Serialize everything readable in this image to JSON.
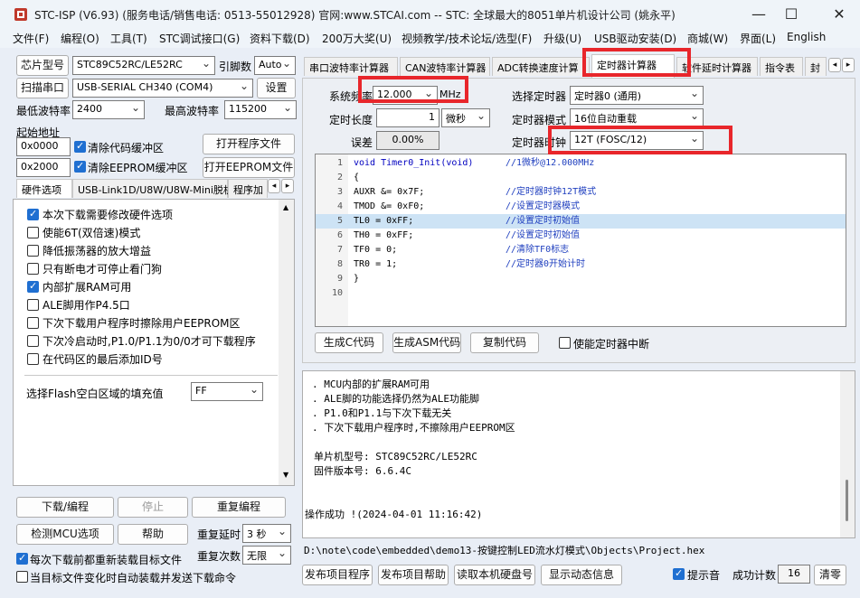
{
  "titlebar": {
    "title": "STC-ISP (V6.93) (服务电话/销售电话: 0513-55012928) 官网:www.STCAI.com  -- STC: 全球最大的8051单片机设计公司 (姚永平)",
    "minimize": "—",
    "maximize": "☐",
    "close": "✕"
  },
  "menu": [
    "文件(F)",
    "编程(O)",
    "工具(T)",
    "STC调试接口(G)",
    "资料下载(D)",
    "200万大奖(U)",
    "视频教学/技术论坛/选型(F)",
    "升级(U)",
    "USB驱动安装(D)",
    "商城(W)",
    "界面(L)",
    "English"
  ],
  "left": {
    "chip_model_btn": "芯片型号",
    "chip_model": "STC89C52RC/LE52RC",
    "pin_label": "引脚数",
    "pin_value": "Auto",
    "scan_port_btn": "扫描串口",
    "port_value": "USB-SERIAL CH340 (COM4)",
    "settings_btn": "设置",
    "min_baud_label": "最低波特率",
    "min_baud": "2400",
    "max_baud_label": "最高波特率",
    "max_baud": "115200",
    "start_addr_label": "起始地址",
    "addr1": "0x0000",
    "clear_code_label": "清除代码缓冲区",
    "open_prog_btn": "打开程序文件",
    "addr2": "0x2000",
    "clear_eeprom_label": "清除EEPROM缓冲区",
    "open_eeprom_btn": "打开EEPROM文件",
    "tabs": [
      "硬件选项",
      "USB-Link1D/U8W/U8W-Mini脱机",
      "程序加"
    ],
    "options": [
      {
        "label": "本次下载需要修改硬件选项",
        "checked": true
      },
      {
        "label": "使能6T(双倍速)模式",
        "checked": false
      },
      {
        "label": "降低振荡器的放大增益",
        "checked": false
      },
      {
        "label": "只有断电才可停止看门狗",
        "checked": false
      },
      {
        "label": "内部扩展RAM可用",
        "checked": true
      },
      {
        "label": "ALE脚用作P4.5口",
        "checked": false
      },
      {
        "label": "下次下载用户程序时擦除用户EEPROM区",
        "checked": false
      },
      {
        "label": "下次冷启动时,P1.0/P1.1为0/0才可下载程序",
        "checked": false
      },
      {
        "label": "在代码区的最后添加ID号",
        "checked": false
      }
    ],
    "fill_label": "选择Flash空白区域的填充值",
    "fill_value": "FF",
    "download_btn": "下载/编程",
    "stop_btn": "停止",
    "reprog_btn": "重复编程",
    "check_mcu_btn": "检测MCU选项",
    "help_btn": "帮助",
    "repeat_delay_label": "重复延时",
    "repeat_delay": "3 秒",
    "repeat_count_label": "重复次数",
    "repeat_count": "无限",
    "reload_label": "每次下载前都重新装载目标文件",
    "auto_send_label": "当目标文件变化时自动装载并发送下载命令"
  },
  "right": {
    "tabs": [
      "串口波特率计算器",
      "CAN波特率计算器",
      "ADC转换速度计算",
      "定时器计算器",
      "软件延时计算器",
      "指令表",
      "封"
    ],
    "sysfreq_label": "系统频率",
    "sysfreq": "12.000",
    "sysfreq_unit": "MHz",
    "timer_sel_label": "选择定时器",
    "timer_sel": "定时器0 (通用)",
    "timer_len_label": "定时长度",
    "timer_len": "1",
    "timer_unit": "微秒",
    "timer_mode_label": "定时器模式",
    "timer_mode": "16位自动重载",
    "error_label": "误差",
    "error_value": "0.00%",
    "timer_clock_label": "定时器时钟",
    "timer_clock": "12T (FOSC/12)",
    "code_lines": [
      {
        "n": "1",
        "code": "void Timer0_Init(void)",
        "comment": "//1微秒@12.000MHz"
      },
      {
        "n": "2",
        "code": "{",
        "comment": ""
      },
      {
        "n": "3",
        "code": "    AUXR &= 0x7F;",
        "comment": "//定时器时钟12T模式"
      },
      {
        "n": "4",
        "code": "    TMOD &= 0xF0;",
        "comment": "//设置定时器模式"
      },
      {
        "n": "5",
        "code": "    TL0 = 0xFF;",
        "comment": "//设置定时初始值"
      },
      {
        "n": "6",
        "code": "    TH0 = 0xFF;",
        "comment": "//设置定时初始值"
      },
      {
        "n": "7",
        "code": "    TF0 = 0;",
        "comment": "//清除TF0标志"
      },
      {
        "n": "8",
        "code": "    TR0 = 1;",
        "comment": "//定时器0开始计时"
      },
      {
        "n": "9",
        "code": "}",
        "comment": ""
      },
      {
        "n": "10",
        "code": "",
        "comment": ""
      }
    ],
    "gen_c_btn": "生成C代码",
    "gen_asm_btn": "生成ASM代码",
    "copy_btn": "复制代码",
    "enable_irq_label": "使能定时器中断",
    "log_lines": [
      ". MCU内部的扩展RAM可用",
      ". ALE脚的功能选择仍然为ALE功能脚",
      ". P1.0和P1.1与下次下载无关",
      ". 下次下载用户程序时,不擦除用户EEPROM区",
      "",
      "单片机型号: STC89C52RC/LE52RC",
      "固件版本号: 6.6.4C",
      "",
      "",
      "操作成功 !(2024-04-01 11:16:42)"
    ],
    "path": "D:\\note\\code\\embedded\\demo13-按键控制LED流水灯模式\\Objects\\Project.hex",
    "publish_btn": "发布项目程序",
    "publish_help_btn": "发布项目帮助",
    "read_disk_btn": "读取本机硬盘号",
    "show_dynamic_btn": "显示动态信息",
    "beep_label": "提示音",
    "success_label": "成功计数",
    "success_count": "16",
    "clear_btn": "清零"
  },
  "colors": {
    "accent": "#1f6fd1",
    "highlight_box": "#e8262b",
    "code_line_highlight": "#cde3f5"
  }
}
